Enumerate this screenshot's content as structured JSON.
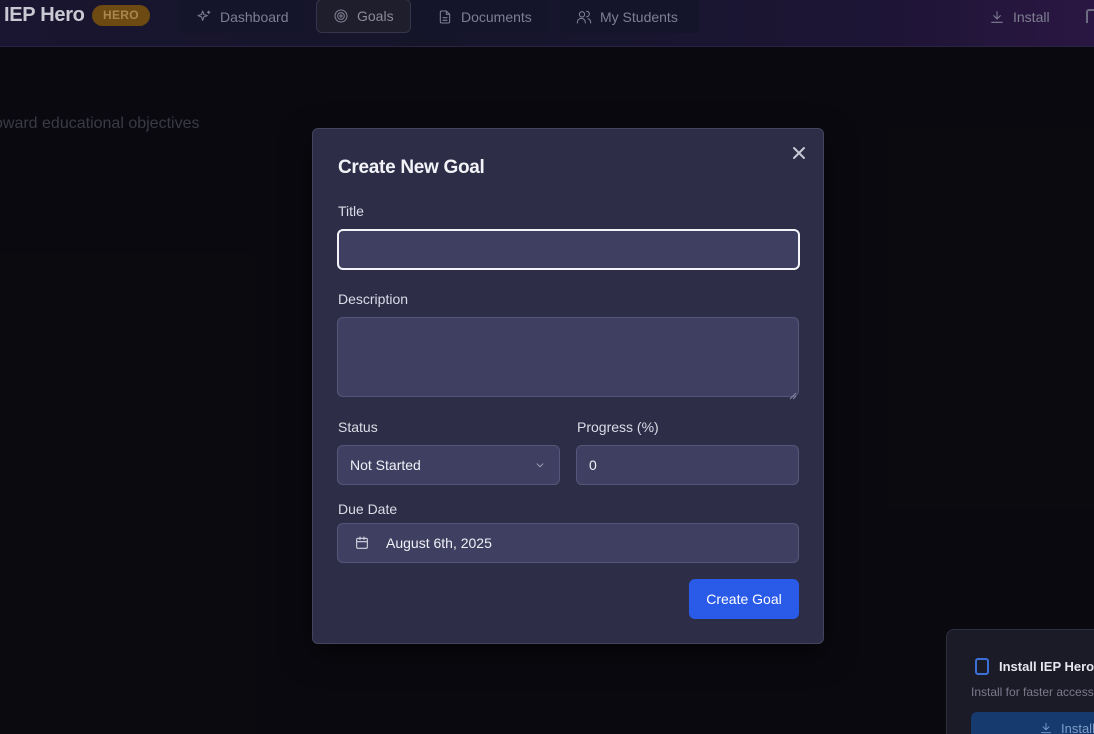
{
  "app": {
    "brand": "IEP Hero",
    "badge": "HERO"
  },
  "nav": {
    "dashboard": "Dashboard",
    "goals": "Goals",
    "documents": "Documents",
    "students": "My Students",
    "install": "Install"
  },
  "background": {
    "subtitle": "oward educational objectives"
  },
  "modal": {
    "title": "Create New Goal",
    "title_label": "Title",
    "title_value": "",
    "description_label": "Description",
    "description_value": "",
    "status_label": "Status",
    "status_value": "Not Started",
    "progress_label": "Progress (%)",
    "progress_value": "0",
    "due_date_label": "Due Date",
    "due_date_value": "August 6th, 2025",
    "submit_label": "Create Goal"
  },
  "toast": {
    "title": "Install IEP Hero",
    "subtitle": "Install for faster access",
    "button": "Install"
  },
  "colors": {
    "primary": "#2a5ae8",
    "modal_bg": "#2d2d48",
    "field_bg": "#3f3f62",
    "badge_bg": "#6d4a12"
  }
}
